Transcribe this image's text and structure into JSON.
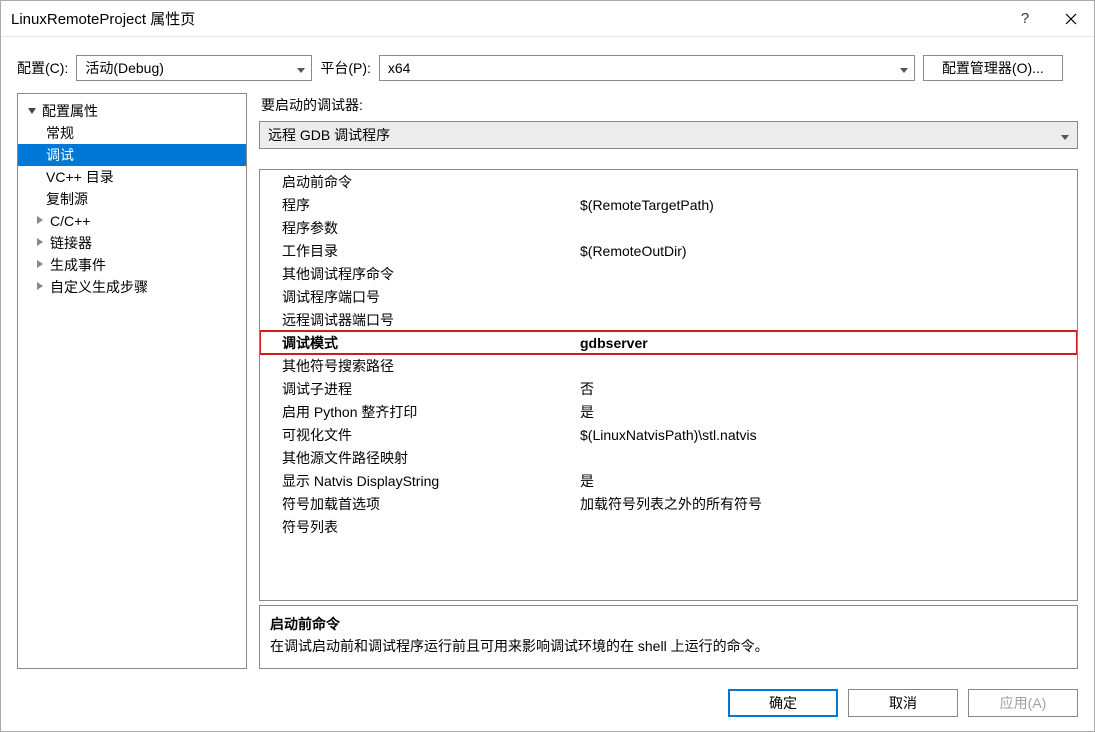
{
  "window": {
    "title": "LinuxRemoteProject 属性页"
  },
  "top": {
    "config_label": "配置(C):",
    "config_value": "活动(Debug)",
    "platform_label": "平台(P):",
    "platform_value": "x64",
    "config_mgr": "配置管理器(O)..."
  },
  "tree": {
    "root": "配置属性",
    "items": [
      {
        "label": "常规",
        "selected": false,
        "expandable": false
      },
      {
        "label": "调试",
        "selected": true,
        "expandable": false
      },
      {
        "label": "VC++ 目录",
        "selected": false,
        "expandable": false
      },
      {
        "label": "复制源",
        "selected": false,
        "expandable": false
      },
      {
        "label": "C/C++",
        "selected": false,
        "expandable": true
      },
      {
        "label": "链接器",
        "selected": false,
        "expandable": true
      },
      {
        "label": "生成事件",
        "selected": false,
        "expandable": true
      },
      {
        "label": "自定义生成步骤",
        "selected": false,
        "expandable": true
      }
    ]
  },
  "right": {
    "debugger_label": "要启动的调试器:",
    "debugger_value": "远程 GDB 调试程序",
    "props": [
      {
        "k": "启动前命令",
        "v": ""
      },
      {
        "k": "程序",
        "v": "$(RemoteTargetPath)"
      },
      {
        "k": "程序参数",
        "v": ""
      },
      {
        "k": "工作目录",
        "v": "$(RemoteOutDir)"
      },
      {
        "k": "其他调试程序命令",
        "v": ""
      },
      {
        "k": "调试程序端口号",
        "v": ""
      },
      {
        "k": "远程调试器端口号",
        "v": ""
      },
      {
        "k": "调试模式",
        "v": "gdbserver",
        "highlight": true
      },
      {
        "k": "其他符号搜索路径",
        "v": ""
      },
      {
        "k": "调试子进程",
        "v": "否"
      },
      {
        "k": "启用 Python 整齐打印",
        "v": "是"
      },
      {
        "k": "可视化文件",
        "v": "$(LinuxNatvisPath)\\stl.natvis"
      },
      {
        "k": "其他源文件路径映射",
        "v": ""
      },
      {
        "k": "显示 Natvis DisplayString",
        "v": "是"
      },
      {
        "k": "符号加载首选项",
        "v": "加载符号列表之外的所有符号"
      },
      {
        "k": "符号列表",
        "v": ""
      }
    ],
    "desc": {
      "title": "启动前命令",
      "body": "在调试启动前和调试程序运行前且可用来影响调试环境的在 shell 上运行的命令。"
    }
  },
  "buttons": {
    "ok": "确定",
    "cancel": "取消",
    "apply": "应用(A)"
  }
}
